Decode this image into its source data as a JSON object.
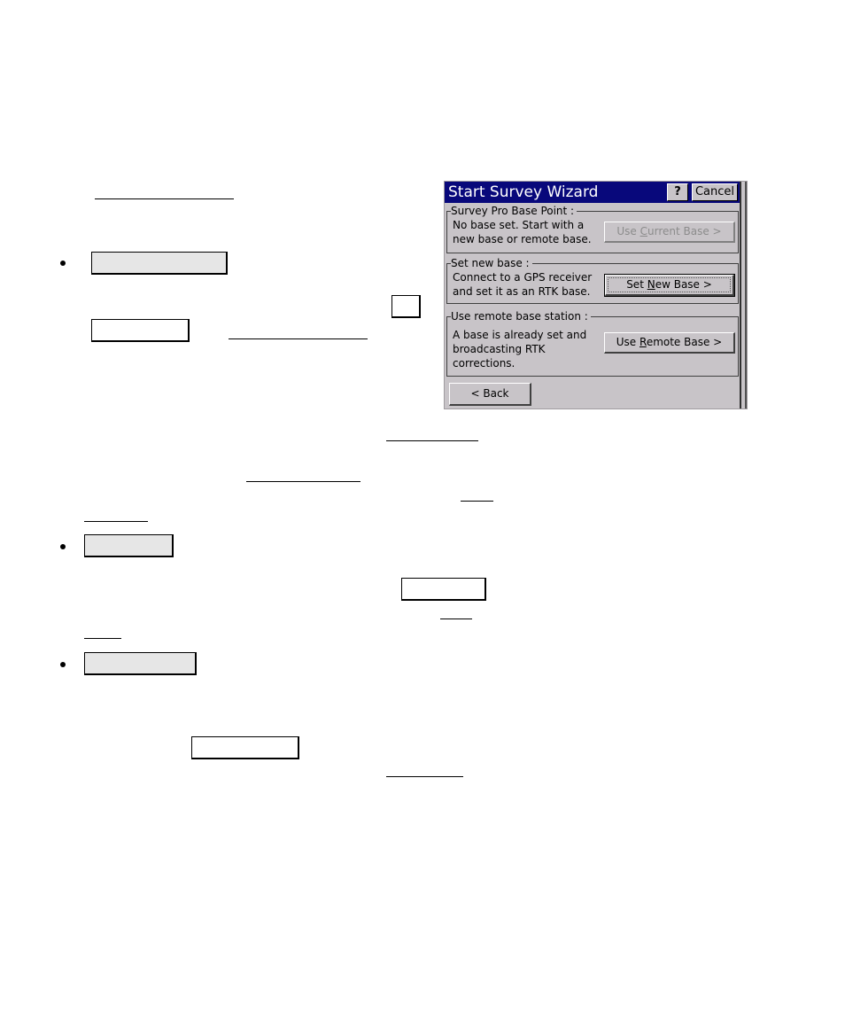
{
  "dialog": {
    "title": "Start Survey Wizard",
    "help_label": "?",
    "cancel_label": "Cancel",
    "colors": {
      "titlebar": "#08087b",
      "face": "#c8c4c8",
      "disabled_text": "#8c8c8c"
    },
    "groups": [
      {
        "legend": "Survey Pro Base Point :",
        "description": "No base set. Start with a\nnew base or remote base.",
        "button": {
          "pre": "Use ",
          "accel": "C",
          "post": "urrent Base >",
          "enabled": false
        }
      },
      {
        "legend": "Set new base :",
        "description": "Connect to a GPS receiver\nand set it as an RTK base.",
        "button": {
          "pre": "Set ",
          "accel": "N",
          "post": "ew Base >",
          "enabled": true,
          "default": true
        }
      },
      {
        "legend": "Use remote base station :",
        "description": "A base is already set and\nbroadcasting RTK\ncorrections.",
        "button": {
          "pre": "Use ",
          "accel": "R",
          "post": "emote Base >",
          "enabled": true
        }
      }
    ],
    "back_label": "< Back"
  },
  "document": {
    "bullets": 3
  }
}
